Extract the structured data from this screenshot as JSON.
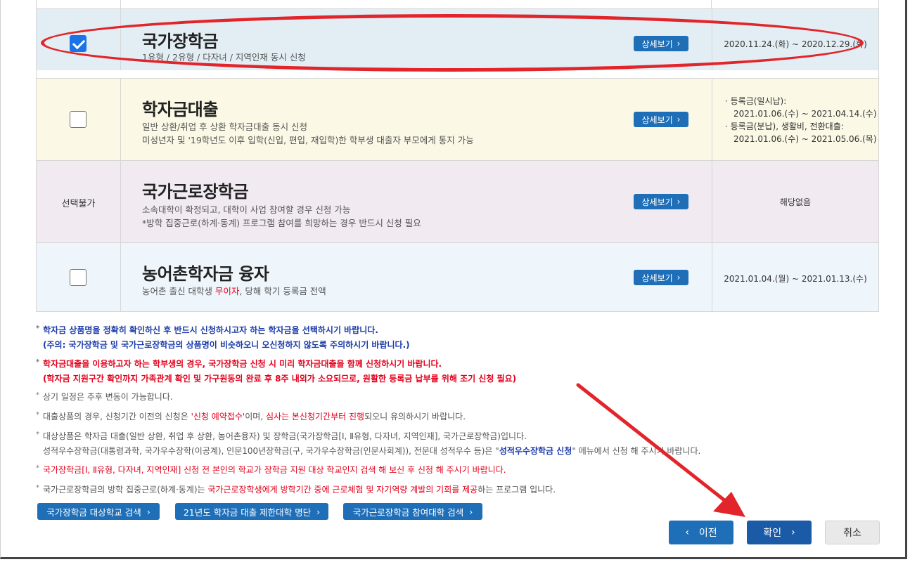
{
  "rows": [
    {
      "checked": true,
      "title": "국가장학금",
      "desc": [
        "1유형 / 2유형 / 다자녀 / 지역인재 동시 신청"
      ],
      "detail_label": "상세보기",
      "period": "2020.11.24.(화) ~ 2020.12.29.(화)"
    },
    {
      "checked": false,
      "title": "학자금대출",
      "desc": [
        "일반 상환/취업 후 상환 학자금대출 동시 신청",
        "미성년자 및 '19학년도 이후 입학(신입, 편입, 재입학)한 학부생 대출자 부모에게 통지 가능"
      ],
      "detail_label": "상세보기",
      "period_lines": [
        "· 등록금(일시납):",
        "2021.01.06.(수) ~ 2021.04.14.(수)",
        "· 등록금(분납), 생활비, 전환대출:",
        "2021.01.06.(수) ~ 2021.05.06.(목)"
      ]
    },
    {
      "unavailable_label": "선택불가",
      "title": "국가근로장학금",
      "desc": [
        "소속대학이 확정되고, 대학이 사업 참여할 경우 신청 가능",
        "*방학 집중근로(하계·동계) 프로그램 참여를 희망하는 경우 반드시 신청 필요"
      ],
      "detail_label": "상세보기",
      "period": "해당없음"
    },
    {
      "checked": false,
      "title": "농어촌학자금 융자",
      "desc_pre": "농어촌 출신 대학생 ",
      "desc_red": "무이자",
      "desc_post": ", 당해 학기 등록금 전액",
      "detail_label": "상세보기",
      "period": "2021.01.04.(월) ~ 2021.01.13.(수)"
    }
  ],
  "notes": {
    "n1_a": "학자금 상품명을 정확히 확인하신 후 반드시 신청하시고자 하는 학자금을 선택하시기 바랍니다.",
    "n1_b": "(주의: 국가장학금 및 국가근로장학금의 상품명이 비슷하오니 오신청하지 않도록 주의하시기 바랍니다.)",
    "n2_a": "학자금대출을 이용하고자 하는 학부생의 경우, 국가장학금 신청 시 미리 학자금대출을 함께 신청하시기 바랍니다.",
    "n2_b": "(학자금 지원구간 확인까지 가족관계 확인 및 가구원동의 완료 후 8주 내외가 소요되므로, 원활한 등록금 납부를 위해 조기 신청 필요)",
    "n3": "상기 일정은 추후 변동이 가능합니다.",
    "n4_a": "대출상품의 경우, 신청기간 이전의 신청은 ",
    "n4_r1": "'신청 예약접수'",
    "n4_b": "이며, ",
    "n4_r2": "심사는 본신청기간부터 진행",
    "n4_c": "되오니 유의하시기 바랍니다.",
    "n5_a": "대상상품은 학자금 대출(일반 상환, 취업 후 상환, 농어촌융자) 및 장학금(국가장학금[Ⅰ, Ⅱ유형, 다자녀, 지역인재], 국가근로장학금)입니다.",
    "n5_b": "성적우수장학금(대통령과학, 국가우수장학(이공계), 인문100년장학금(구, 국가우수장학금(인문사회계)), 전문대 성적우수 등)은 \"",
    "n5_bold": "성적우수장학금 신청",
    "n5_c": "\" 메뉴에서 신청 해 주시기 바랍니다.",
    "n6": "국가장학금[Ⅰ, Ⅱ유형, 다자녀, 지역인재] 신청 전 본인의 학교가 장학금 지원 대상 학교인지 검색 해 보신 후 신청 해 주시기 바랍니다.",
    "n7_a": "국가근로장학금의 방학 집중근로(하계·동계)는 ",
    "n7_r": "국가근로장학생에게 방학기간 중에 근로체험 및 자기역량 계발의 기회를 제공",
    "n7_b": "하는 프로그램 입니다."
  },
  "links": {
    "school_search": "국가장학금 대상학교 검색",
    "loan_limit": "21년도 학자금 대출 제한대학 명단",
    "work_univ": "국가근로장학금 참여대학 검색"
  },
  "nav": {
    "prev": "이전",
    "ok": "확인",
    "cancel": "취소"
  },
  "colors": {
    "primary_button": "#1f6fb8",
    "annotation_red": "#e1252b"
  }
}
